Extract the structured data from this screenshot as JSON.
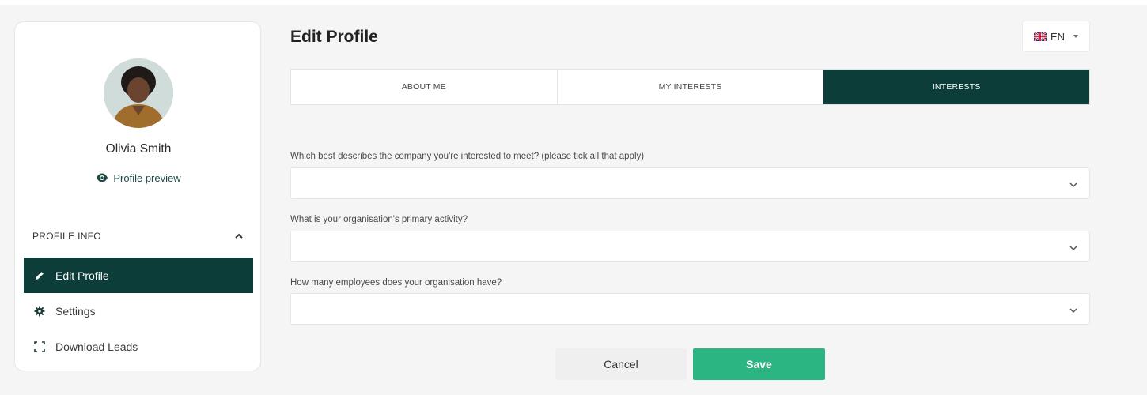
{
  "colors": {
    "primary_dark": "#0d3d38",
    "save_green": "#2bb583",
    "page_bg": "#f5f5f6"
  },
  "sidebar": {
    "avatar_icon": "avatar",
    "user_name": "Olivia Smith",
    "profile_preview": {
      "icon": "eye-icon",
      "label": "Profile preview"
    },
    "section": {
      "label": "PROFILE INFO",
      "icon": "chevron-up-icon",
      "expanded": true
    },
    "items": [
      {
        "label": "Edit Profile",
        "icon": "pencil-icon",
        "active": true
      },
      {
        "label": "Settings",
        "icon": "gear-icon",
        "active": false
      },
      {
        "label": "Download Leads",
        "icon": "scan-frame-icon",
        "active": false
      }
    ]
  },
  "main": {
    "title": "Edit Profile",
    "language": {
      "flag_icon": "uk-flag-icon",
      "value": "EN"
    },
    "tabs": [
      {
        "label": "ABOUT ME",
        "active": false
      },
      {
        "label": "MY INTERESTS",
        "active": false
      },
      {
        "label": "INTERESTS",
        "active": true
      }
    ],
    "questions": [
      {
        "label": "Which best describes the company you're interested to meet? (please tick all that apply)",
        "value": ""
      },
      {
        "label": "What is your organisation's primary activity?",
        "value": ""
      },
      {
        "label": "How many employees does your organisation have?",
        "value": ""
      }
    ],
    "buttons": {
      "cancel": "Cancel",
      "save": "Save"
    }
  }
}
